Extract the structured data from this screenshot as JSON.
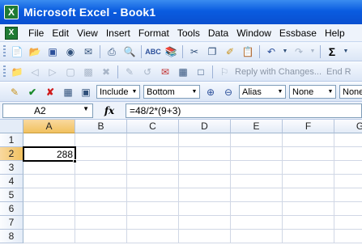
{
  "window": {
    "title": "Microsoft Excel - Book1",
    "app_icon": "excel-icon"
  },
  "menu": {
    "items": [
      {
        "label": "File",
        "name": "menu-file"
      },
      {
        "label": "Edit",
        "name": "menu-edit"
      },
      {
        "label": "View",
        "name": "menu-view"
      },
      {
        "label": "Insert",
        "name": "menu-insert"
      },
      {
        "label": "Format",
        "name": "menu-format"
      },
      {
        "label": "Tools",
        "name": "menu-tools"
      },
      {
        "label": "Data",
        "name": "menu-data"
      },
      {
        "label": "Window",
        "name": "menu-window"
      },
      {
        "label": "Essbase",
        "name": "menu-essbase"
      },
      {
        "label": "Help",
        "name": "menu-help"
      }
    ]
  },
  "toolbar_standard": {
    "icons": [
      "new-icon",
      "open-icon",
      "save-icon",
      "permission-icon",
      "email-icon",
      "print-icon",
      "print-preview-icon",
      "spelling-icon",
      "research-icon",
      "cut-icon",
      "copy-icon",
      "format-painter-icon",
      "paste-icon",
      "undo-icon",
      "redo-icon",
      "autosum-icon"
    ]
  },
  "toolbar_review": {
    "reply_label": "Reply with Changes...",
    "end_review_label": "End R"
  },
  "toolbar_essbase": {
    "include_label": "Include",
    "bottom_label": "Bottom",
    "alias_label": "Alias",
    "none1_label": "None",
    "none2_label": "None"
  },
  "formula_bar": {
    "name_box": "A2",
    "fx_label": "fx",
    "formula": "=48/2*(9+3)"
  },
  "grid": {
    "columns": [
      "A",
      "B",
      "C",
      "D",
      "E",
      "F",
      "G"
    ],
    "rows": [
      "1",
      "2",
      "3",
      "4",
      "5",
      "6",
      "7",
      "8"
    ],
    "active_cell": "A2",
    "cells": {
      "A2": "288"
    }
  },
  "colors": {
    "title_bar": "#0a5ce0",
    "selection_header": "#f1c15f",
    "gridline": "#d0d7e5"
  }
}
